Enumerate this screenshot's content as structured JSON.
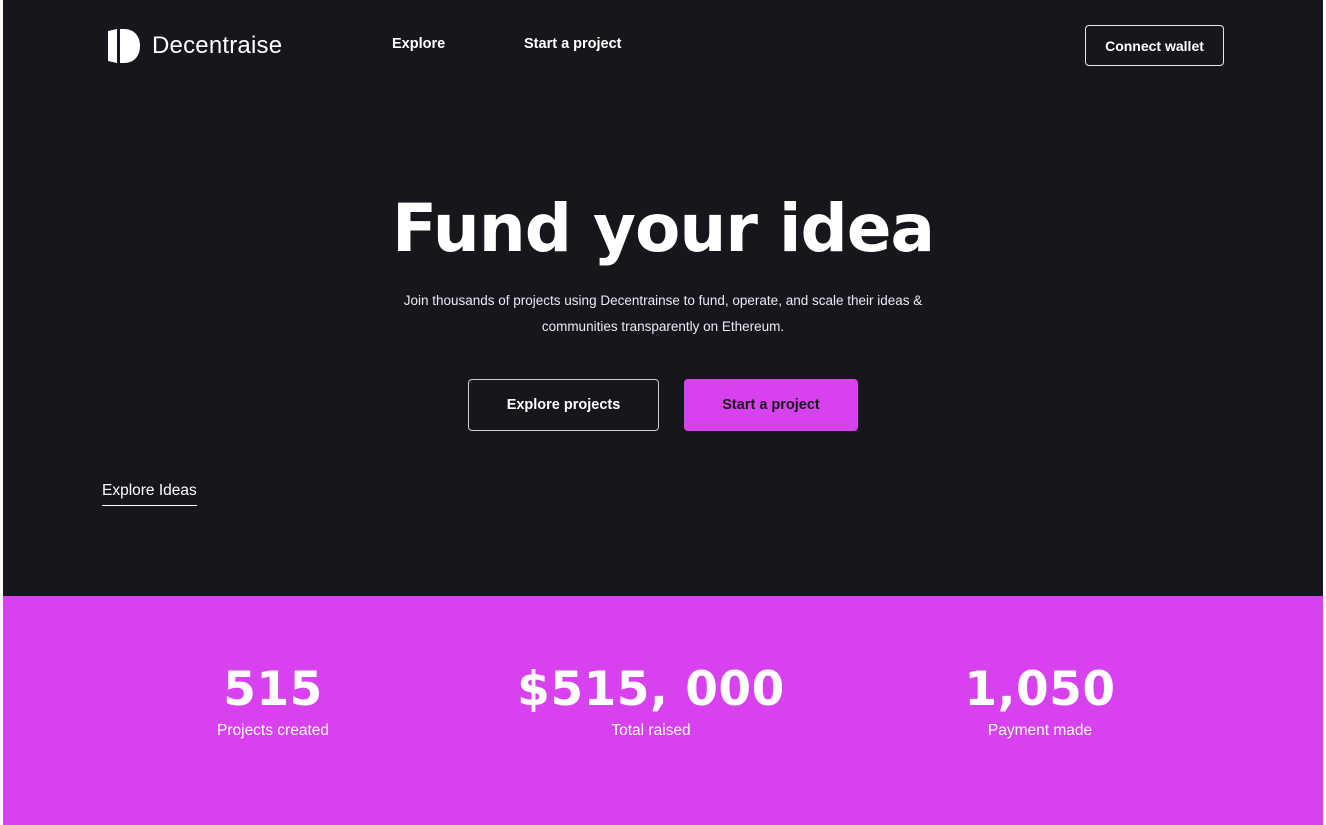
{
  "brand": {
    "name": "Decentraise",
    "logo_icon": "decentraise-logo-icon"
  },
  "nav": {
    "links": [
      "Explore",
      "Start a project"
    ],
    "connect_wallet": "Connect wallet"
  },
  "hero": {
    "title": "Fund your idea",
    "subtitle_lines": [
      "Join thousands of projects using Decentrainse to fund, operate, and scale their ideas &",
      "communities transparently on Ethereum."
    ],
    "primary_cta": "Explore projects",
    "secondary_cta": "Start a project"
  },
  "explore_ideas": "Explore Ideas",
  "stats": [
    {
      "value": "515",
      "label": "Projects created"
    },
    {
      "value": "$515, 000",
      "label": "Total raised"
    },
    {
      "value": "1,050",
      "label": "Payment made"
    }
  ],
  "colors": {
    "background": "#18161d",
    "accent": "#d742ee",
    "text": "#ffffff"
  }
}
